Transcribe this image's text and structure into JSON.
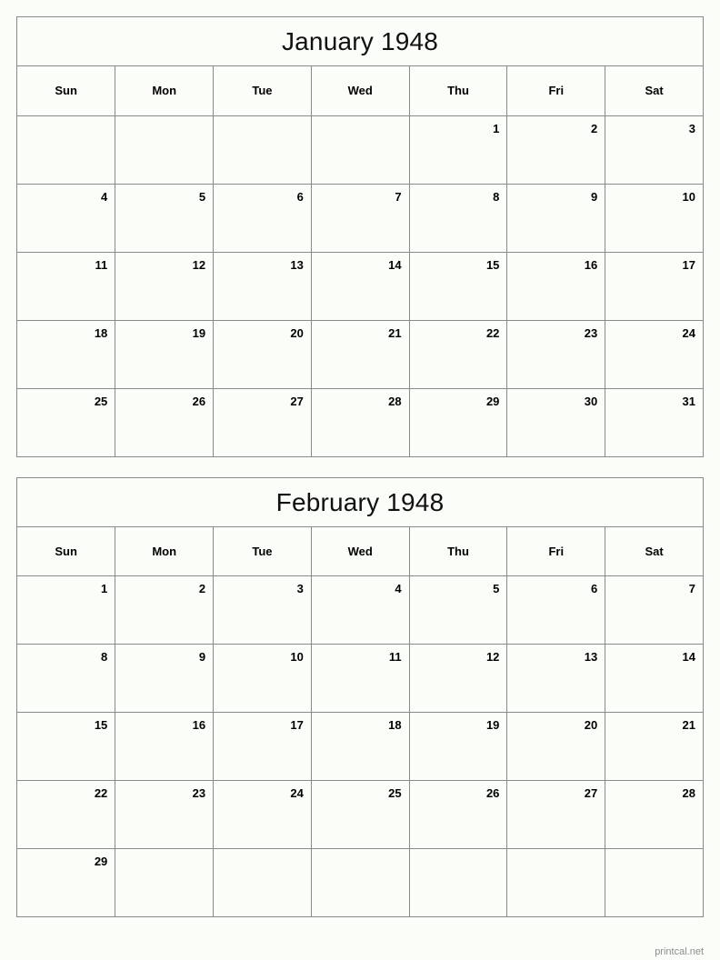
{
  "page": {
    "footer_text": "printcal.net",
    "border_color": "#8a8a8a",
    "background_color": "#fbfdf8",
    "text_color": "#000000",
    "footer_color": "#8d8d8d"
  },
  "weekdays": [
    "Sun",
    "Mon",
    "Tue",
    "Wed",
    "Thu",
    "Fri",
    "Sat"
  ],
  "months": [
    {
      "title": "January 1948",
      "weeks": [
        [
          "",
          "",
          "",
          "",
          "1",
          "2",
          "3"
        ],
        [
          "4",
          "5",
          "6",
          "7",
          "8",
          "9",
          "10"
        ],
        [
          "11",
          "12",
          "13",
          "14",
          "15",
          "16",
          "17"
        ],
        [
          "18",
          "19",
          "20",
          "21",
          "22",
          "23",
          "24"
        ],
        [
          "25",
          "26",
          "27",
          "28",
          "29",
          "30",
          "31"
        ]
      ]
    },
    {
      "title": "February 1948",
      "weeks": [
        [
          "1",
          "2",
          "3",
          "4",
          "5",
          "6",
          "7"
        ],
        [
          "8",
          "9",
          "10",
          "11",
          "12",
          "13",
          "14"
        ],
        [
          "15",
          "16",
          "17",
          "18",
          "19",
          "20",
          "21"
        ],
        [
          "22",
          "23",
          "24",
          "25",
          "26",
          "27",
          "28"
        ],
        [
          "29",
          "",
          "",
          "",
          "",
          "",
          ""
        ]
      ]
    }
  ]
}
